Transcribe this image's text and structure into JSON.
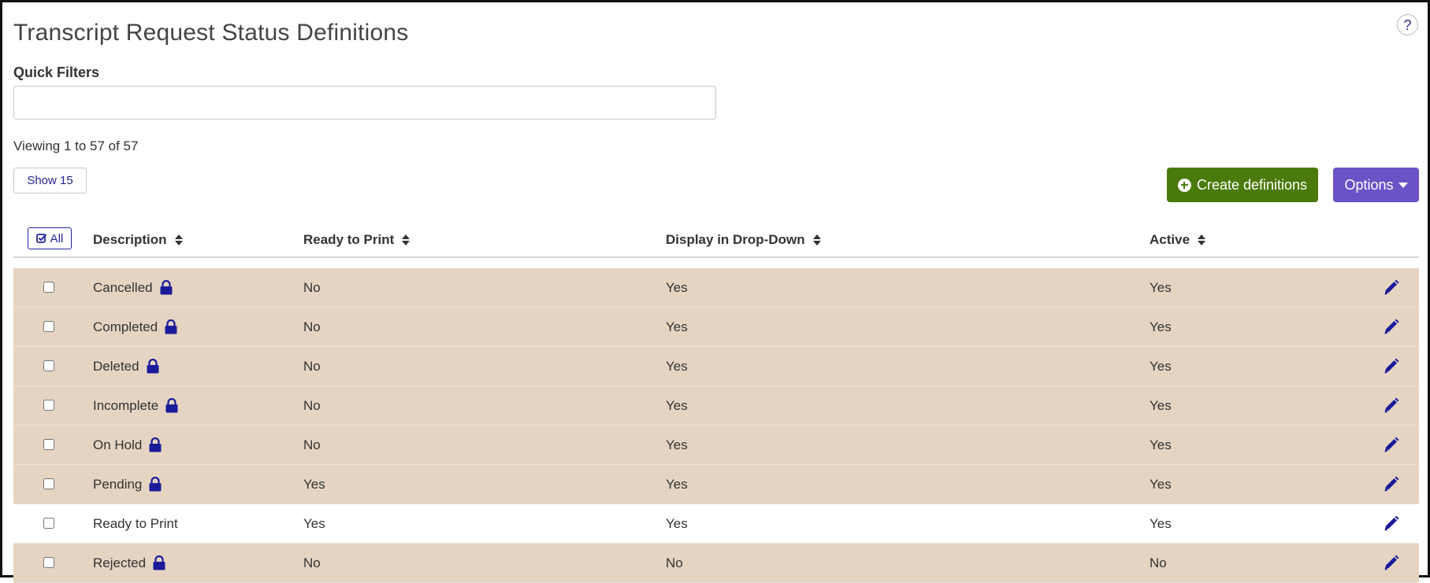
{
  "page": {
    "title": "Transcript Request Status Definitions",
    "help_label": "?"
  },
  "filters": {
    "label": "Quick Filters",
    "value": "",
    "placeholder": ""
  },
  "pagination": {
    "viewing_text": "Viewing 1 to 57 of 57",
    "show_label": "Show 15"
  },
  "toolbar": {
    "create_label": "Create definitions",
    "options_label": "Options"
  },
  "colors": {
    "row_tan": "#e4d4c1",
    "create_green": "#4b7a0c",
    "options_purple": "#6b52c6",
    "icon_navy": "#1b1b9a"
  },
  "table": {
    "select_all_label": "All",
    "columns": [
      {
        "key": "description",
        "label": "Description"
      },
      {
        "key": "ready",
        "label": "Ready to Print"
      },
      {
        "key": "dropdown",
        "label": "Display in Drop-Down"
      },
      {
        "key": "active",
        "label": "Active"
      }
    ],
    "rows": [
      {
        "description": "Cancelled",
        "locked": true,
        "ready": "No",
        "dropdown": "Yes",
        "active": "Yes"
      },
      {
        "description": "Completed",
        "locked": true,
        "ready": "No",
        "dropdown": "Yes",
        "active": "Yes"
      },
      {
        "description": "Deleted",
        "locked": true,
        "ready": "No",
        "dropdown": "Yes",
        "active": "Yes"
      },
      {
        "description": "Incomplete",
        "locked": true,
        "ready": "No",
        "dropdown": "Yes",
        "active": "Yes"
      },
      {
        "description": "On Hold",
        "locked": true,
        "ready": "No",
        "dropdown": "Yes",
        "active": "Yes"
      },
      {
        "description": "Pending",
        "locked": true,
        "ready": "Yes",
        "dropdown": "Yes",
        "active": "Yes"
      },
      {
        "description": "Ready to Print",
        "locked": false,
        "ready": "Yes",
        "dropdown": "Yes",
        "active": "Yes"
      },
      {
        "description": "Rejected",
        "locked": true,
        "ready": "No",
        "dropdown": "No",
        "active": "No"
      }
    ]
  }
}
